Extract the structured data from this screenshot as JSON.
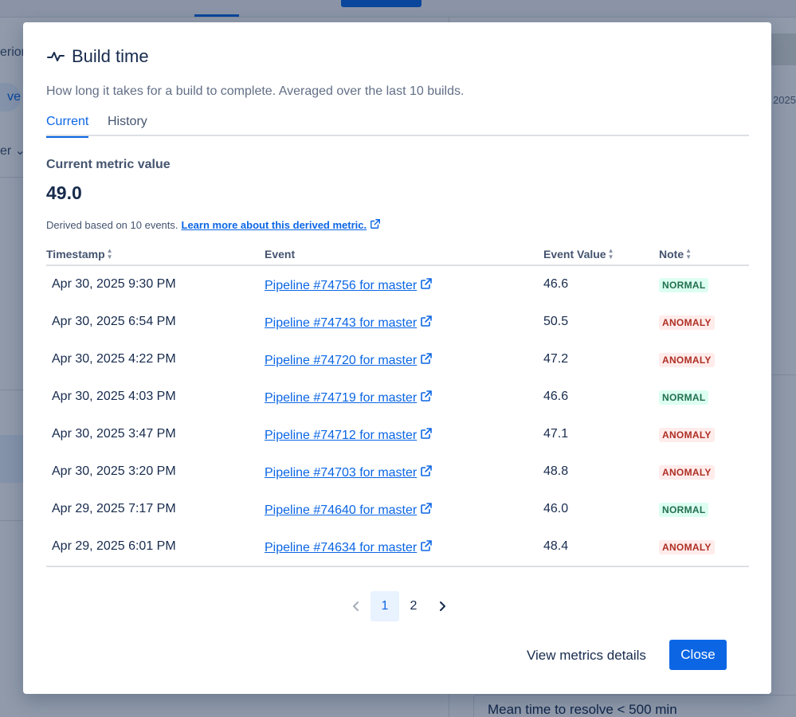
{
  "background": {
    "left_text1": "erion",
    "left_pill": "ve",
    "left_text2": "er ⌄",
    "right_year": "2025",
    "bottom_text": "Mean time to resolve < 500 min"
  },
  "modal": {
    "title": "Build time",
    "description": "How long it takes for a build to complete. Averaged over the last 10 builds.",
    "tabs": [
      {
        "label": "Current",
        "selected": true
      },
      {
        "label": "History",
        "selected": false
      }
    ],
    "metric_label": "Current metric value",
    "metric_value": "49.0",
    "derived_text": "Derived based on 10 events.",
    "derived_link": "Learn more about this derived metric.",
    "table": {
      "headers": {
        "timestamp": "Timestamp",
        "event": "Event",
        "event_value": "Event Value",
        "note": "Note"
      },
      "rows": [
        {
          "timestamp": "Apr 30, 2025 9:30 PM",
          "event": "Pipeline #74756 for master",
          "value": "46.6",
          "note": "NORMAL"
        },
        {
          "timestamp": "Apr 30, 2025 6:54 PM",
          "event": "Pipeline #74743 for master",
          "value": "50.5",
          "note": "ANOMALY"
        },
        {
          "timestamp": "Apr 30, 2025 4:22 PM",
          "event": "Pipeline #74720 for master",
          "value": "47.2",
          "note": "ANOMALY"
        },
        {
          "timestamp": "Apr 30, 2025 4:03 PM",
          "event": "Pipeline #74719 for master",
          "value": "46.6",
          "note": "NORMAL"
        },
        {
          "timestamp": "Apr 30, 2025 3:47 PM",
          "event": "Pipeline #74712 for master",
          "value": "47.1",
          "note": "ANOMALY"
        },
        {
          "timestamp": "Apr 30, 2025 3:20 PM",
          "event": "Pipeline #74703 for master",
          "value": "48.8",
          "note": "ANOMALY"
        },
        {
          "timestamp": "Apr 29, 2025 7:17 PM",
          "event": "Pipeline #74640 for master",
          "value": "46.0",
          "note": "NORMAL"
        },
        {
          "timestamp": "Apr 29, 2025 6:01 PM",
          "event": "Pipeline #74634 for master",
          "value": "48.4",
          "note": "ANOMALY"
        }
      ]
    },
    "pagination": {
      "pages": [
        "1",
        "2"
      ],
      "current": "1"
    },
    "footer": {
      "details_link": "View metrics details",
      "close_label": "Close"
    }
  },
  "colors": {
    "accent": "#0c66e4",
    "normal_bg": "#dcfff1",
    "normal_text": "#216e4e",
    "anomaly_bg": "#ffeceb",
    "anomaly_text": "#ae2e24"
  },
  "icons": {
    "title_icon": "activity-pulse-icon",
    "external_link_icon": "external-link-icon",
    "sort_icon": "sort-arrows-icon",
    "prev_icon": "chevron-left-icon",
    "next_icon": "chevron-right-icon"
  }
}
